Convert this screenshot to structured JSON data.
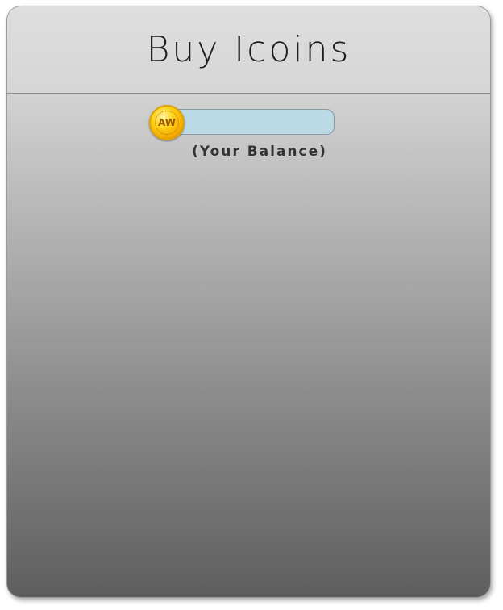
{
  "header": {
    "title": "Buy Icoins"
  },
  "balance": {
    "coin_icon": "coin-icon",
    "coin_text": "AW",
    "value": "",
    "label": "(Your Balance)"
  },
  "colors": {
    "balance_bar": "#bcd9e6",
    "coin_gold": "#ffd21a"
  }
}
